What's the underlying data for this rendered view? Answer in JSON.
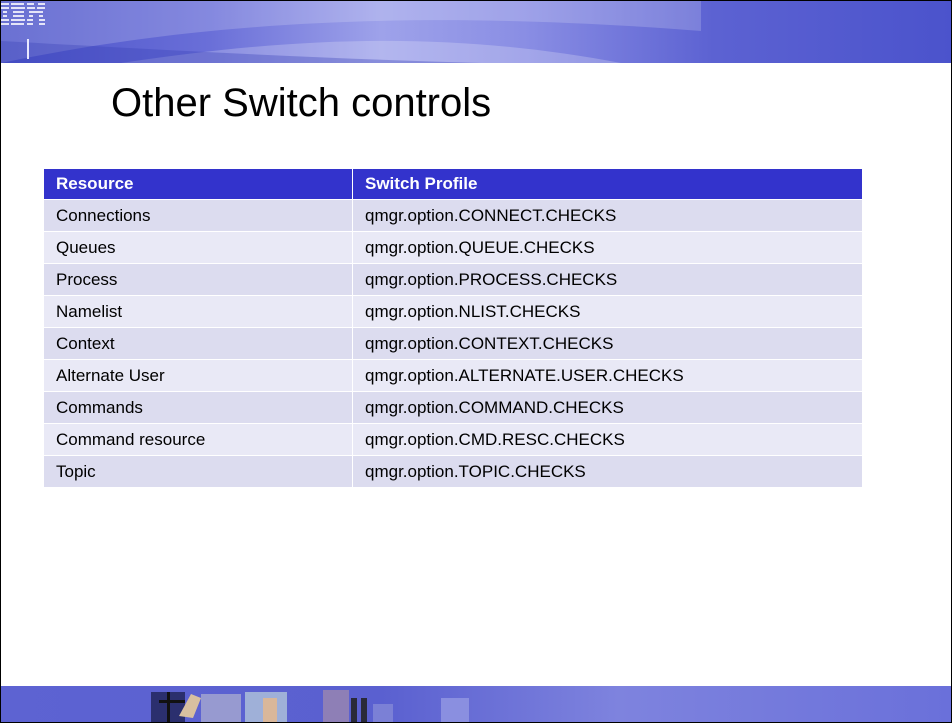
{
  "slide": {
    "title": "Other Switch controls",
    "logo_text": "IBM"
  },
  "table": {
    "headers": [
      "Resource",
      "Switch Profile"
    ],
    "rows": [
      {
        "resource": "Connections",
        "profile": "qmgr.option.CONNECT.CHECKS"
      },
      {
        "resource": "Queues",
        "profile": "qmgr.option.QUEUE.CHECKS"
      },
      {
        "resource": "Process",
        "profile": "qmgr.option.PROCESS.CHECKS"
      },
      {
        "resource": "Namelist",
        "profile": "qmgr.option.NLIST.CHECKS"
      },
      {
        "resource": "Context",
        "profile": "qmgr.option.CONTEXT.CHECKS"
      },
      {
        "resource": "Alternate User",
        "profile": "qmgr.option.ALTERNATE.USER.CHECKS"
      },
      {
        "resource": "Commands",
        "profile": "qmgr.option.COMMAND.CHECKS"
      },
      {
        "resource": "Command resource",
        "profile": "qmgr.option.CMD.RESC.CHECKS"
      },
      {
        "resource": "Topic",
        "profile": "qmgr.option.TOPIC.CHECKS"
      }
    ]
  },
  "colors": {
    "header_bg": "#3333cc",
    "row_bg": "#dcdcef",
    "row_alt_bg": "#e9e9f6",
    "banner": "#4a52c9"
  },
  "icons": [
    "ibm-logo-icon",
    "banner-swoosh-graphic",
    "footer-photo-strip"
  ]
}
